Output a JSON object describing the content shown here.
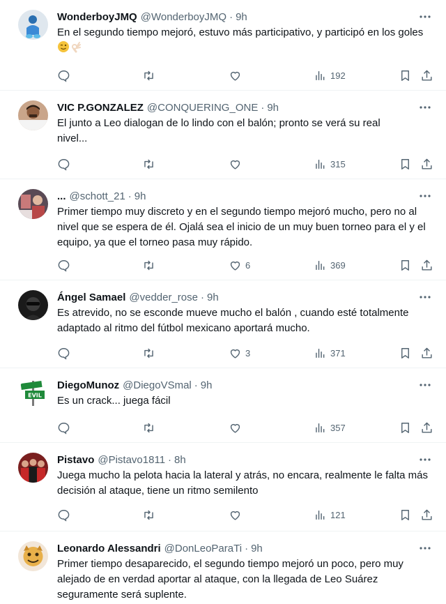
{
  "tweets": [
    {
      "name": "WonderboyJMQ",
      "handle": "@WonderboyJMQ",
      "time": "9h",
      "text": "En el segundo tiempo mejoró, estuvo más participativo, y participó en los goles",
      "emojis": [
        "winking-face-emoji",
        "ok-hand-emoji"
      ],
      "replies": "",
      "retweets": "",
      "likes": "",
      "views": "192"
    },
    {
      "name": "VIC P.GONZALEZ",
      "handle": "@CONQUERING_ONE",
      "time": "9h",
      "text": "El junto a Leo dialogan de lo lindo con el balón; pronto se verá su real nivel...",
      "replies": "",
      "retweets": "",
      "likes": "",
      "views": "315"
    },
    {
      "name": "...",
      "handle": "@schott_21",
      "time": "9h",
      "text": "Primer tiempo muy discreto y en el segundo tiempo mejoró mucho, pero no al nivel que se espera de él. Ojalá sea el inicio de un muy buen torneo para el y el equipo, ya que el torneo pasa muy rápido.",
      "replies": "",
      "retweets": "",
      "likes": "6",
      "views": "369"
    },
    {
      "name": "Ángel Samael",
      "handle": "@vedder_rose",
      "time": "9h",
      "text": "Es atrevido, no se esconde mueve mucho el balón , cuando esté totalmente adaptado al ritmo del fútbol mexicano aportará mucho.",
      "replies": "",
      "retweets": "",
      "likes": "3",
      "views": "371"
    },
    {
      "name": "DiegoMunoz",
      "handle": "@DiegoVSmal",
      "time": "9h",
      "text": "Es un crack... juega fácil",
      "avatar_text": "EVIL",
      "replies": "",
      "retweets": "",
      "likes": "",
      "views": "357"
    },
    {
      "name": "Pistavo",
      "handle": "@Pistavo1811",
      "time": "8h",
      "text": "Juega mucho la pelota hacia la lateral y atrás, no encara, realmente le falta más decisión al ataque, tiene un ritmo semilento",
      "replies": "",
      "retweets": "",
      "likes": "",
      "views": "121"
    },
    {
      "name": "Leonardo Alessandri",
      "handle": "@DonLeoParaTi",
      "time": "9h",
      "text": "Primer tiempo desaparecido, el segundo tiempo mejoró un poco, pero muy alejado de en verdad aportar al ataque, con la llegada de Leo Suárez seguramente será suplente."
    }
  ],
  "icons": {
    "reply": "reply-icon",
    "retweet": "retweet-icon",
    "like": "heart-icon",
    "views": "views-icon",
    "bookmark": "bookmark-icon",
    "share": "share-icon",
    "more": "more-icon"
  },
  "colors": {
    "text": "#0f1419",
    "secondary": "#536471",
    "divider": "#eff3f4"
  }
}
